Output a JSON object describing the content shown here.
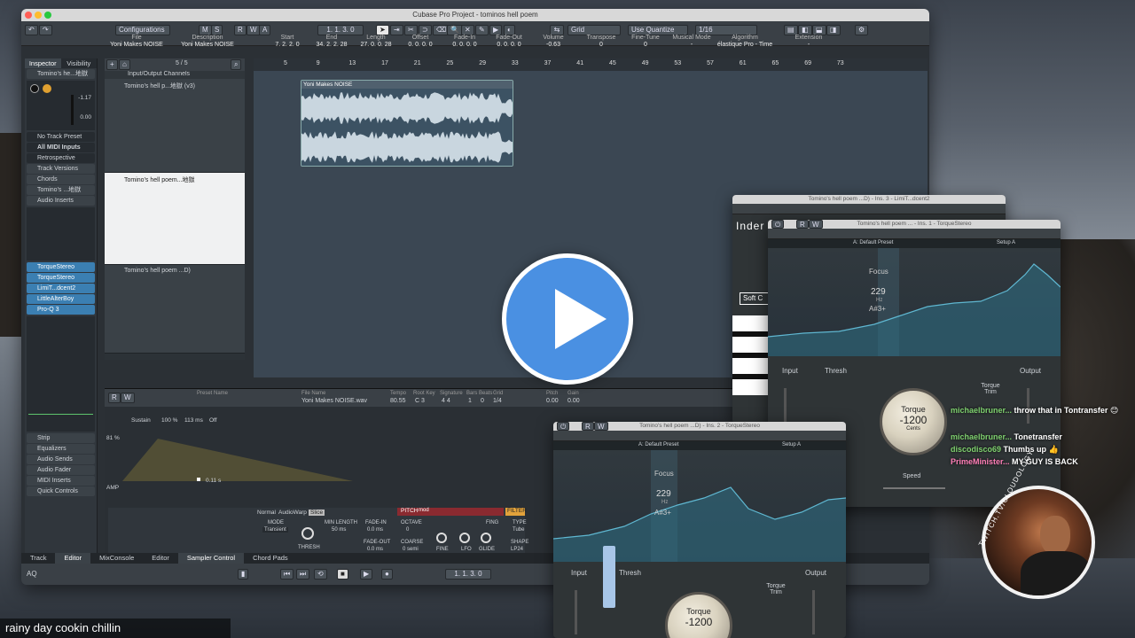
{
  "window": {
    "title": "Cubase Pro Project - tominos hell poem"
  },
  "toolbar": {
    "configurations": "Configurations",
    "m": "M",
    "s": "S",
    "r": "R",
    "w": "W",
    "a": "A",
    "position": "1. 1. 3. 0",
    "grid": "Grid",
    "quantize_mode": "Use Quantize",
    "quantize": "1/16"
  },
  "infoline": [
    {
      "label": "File",
      "value": "Yoni Makes NOISE"
    },
    {
      "label": "Description",
      "value": "Yoni Makes NOISE"
    },
    {
      "label": "Start",
      "value": "7. 2. 2. 0"
    },
    {
      "label": "End",
      "value": "34. 2. 2. 28"
    },
    {
      "label": "Length",
      "value": "27. 0. 0. 28"
    },
    {
      "label": "Offset",
      "value": "0. 0. 0. 0"
    },
    {
      "label": "Fade-In",
      "value": "0. 0. 0. 0"
    },
    {
      "label": "Fade-Out",
      "value": "0. 0. 0. 0"
    },
    {
      "label": "Volume",
      "value": "-0.63"
    },
    {
      "label": "Transpose",
      "value": "0"
    },
    {
      "label": "Fine-Tune",
      "value": "0"
    },
    {
      "label": "Musical Mode",
      "value": "-"
    },
    {
      "label": "Algorithm",
      "value": "élastique Pro - Time"
    },
    {
      "label": "Extension",
      "value": "-"
    }
  ],
  "inspector": {
    "tabs": [
      "Inspector",
      "Visibility"
    ],
    "track_name": "Tomino's he...地獄",
    "no_track_preset": "No Track Preset",
    "all_midi": "All MIDI Inputs",
    "retro": "Retrospective Recording",
    "sections": [
      "Track Versions",
      "Chords",
      "Tomino's ...地獄",
      "Audio Inserts"
    ],
    "inserts": [
      "TorqueStereo",
      "TorqueStereo",
      "LimiT...dcent2",
      "LittleAlterBoy",
      "Pro-Q 3"
    ],
    "sections_bottom": [
      "Strip",
      "Equalizers",
      "Audio Sends",
      "Audio Fader",
      "MIDI Inserts",
      "Quick Controls"
    ],
    "meter_hi": "-1.17",
    "meter_lo": "0.00"
  },
  "tracks": {
    "folder": "Input/Output Channels",
    "counter": "5 / 5",
    "items": [
      {
        "name": "Tomino's hell p...地獄 (v3)"
      },
      {
        "name": "Tomino's hell poem...地獄"
      },
      {
        "name": "Tomino's hell poem ...D)"
      }
    ]
  },
  "ruler": [
    "5",
    "9",
    "13",
    "17",
    "21",
    "25",
    "29",
    "33",
    "37",
    "41",
    "45",
    "49",
    "53",
    "57",
    "61",
    "65",
    "69",
    "73"
  ],
  "clip": {
    "title": "Yoni Makes NOISE"
  },
  "sampler": {
    "preset": "Preset Name",
    "file_name_label": "File Name",
    "file_name": "Yoni Makes NOISE.wav",
    "tempo_label": "Tempo",
    "tempo": "80.55",
    "root_key_label": "Root Key",
    "root_key": "C 3",
    "signature_label": "Signature",
    "signature": "4 4",
    "bars_label": "Bars",
    "bars": "1",
    "beats_label": "Beats",
    "beats": "0",
    "grid_label": "Grid",
    "grid": "1/4",
    "pitch_label": "Pitch",
    "pitch": "0.00",
    "gain_label": "Gain",
    "gain": "0.00",
    "sustain": "Sustain",
    "vel": "100 %",
    "vel2": "113 ms",
    "off": "Off",
    "amp": "AMP",
    "pct": "81 %",
    "time": "0.11 s",
    "modes": [
      "Normal",
      "AudioWarp",
      "Slice"
    ],
    "mode_label": "MODE",
    "mode": "Transient",
    "min_length_label": "MIN LENGTH",
    "min_length": "50 ms",
    "fade_in_label": "FADE-IN",
    "fade_in": "0.0 ms",
    "fade_out_label": "FADE-OUT",
    "fade_out": "0.0 ms",
    "thresh": "THRESH",
    "pitch_head": "PITCH",
    "filter_head": "FILTER",
    "mod": "mod",
    "octave": "OCTAVE",
    "octave_v": "0",
    "coarse": "COARSE",
    "coarse_v": "0 semi",
    "fine": "FINE",
    "lfo": "LFO",
    "glide": "GLIDE",
    "fine_s": "FING",
    "type": "TYPE",
    "type_v": "Tube",
    "shape": "SHAPE",
    "shape_v": "LP24"
  },
  "lower_tabs": [
    "Track",
    "Editor",
    "MixConsole",
    "Editor",
    "Sampler Control",
    "Chord Pads"
  ],
  "transport": {
    "position": "1. 1. 3. 0",
    "aq": "AQ"
  },
  "plugins": {
    "torque_title": "Tomino's hell poem ...D) - Ins. 2 - TorqueStereo",
    "torque2_title": "Tomino's hell poem ... - Ins. 1 - TorqueStereo",
    "inder_title": "Tomino's hell poem ...D) - Ins. 3 - LimiT...dcent2",
    "inder": "Inder",
    "soft": "Soft C",
    "preset_default": "A: Default Preset",
    "setup": "Setup A",
    "focus": "Focus",
    "focus_val": "229",
    "focus_unit": "Hz",
    "note": "A#3+",
    "input": "Input",
    "output": "Output",
    "thresh": "Thresh",
    "torque_trim": "Torque Trim",
    "torque": "Torque",
    "torque_val": "-1200",
    "cents": "Cents",
    "speed": "Speed",
    "filt": "filt"
  },
  "chat": [
    {
      "user": "michaelbruner...",
      "msg": "throw that in Tontransfer 😊"
    },
    {
      "user": "michaelbruner...",
      "msg": "Tonetransfer"
    },
    {
      "user": "discodisco69",
      "msg": "Thumbs up 👍"
    },
    {
      "user": "PrimeMinister...",
      "msg": "MY GUY IS BACK"
    }
  ],
  "twitch": "TWITCH.TV/CLOUDOLOGY",
  "caption": "rainy  day  cookin  chillin",
  "colors": {
    "accent": "#4a90e2",
    "insert_blue": "#3b7fb2",
    "meter": "#5ec46d",
    "chat_user": "#7fd16f"
  }
}
